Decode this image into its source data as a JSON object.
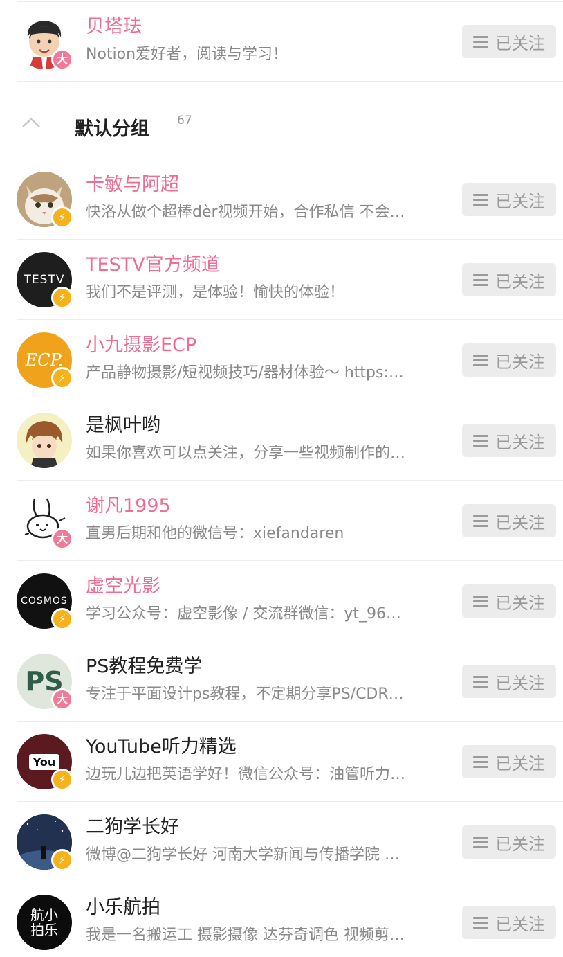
{
  "top_row": {
    "name": "贝塔珐",
    "desc": "Notion爱好者，阅读与学习！",
    "badge": "大",
    "button": "已关注"
  },
  "group": {
    "title": "默认分组",
    "count": "67"
  },
  "colors": {
    "pink_name": "#ef6d90",
    "vip_badge": "#f07a98",
    "bolt_badge": "#f5b21b",
    "button_bg": "#ececec",
    "button_text": "#9a9a9a"
  },
  "list": [
    {
      "name": "卡敏与阿超",
      "desc": "快洛从做个超棒dèr视频开始，合作私信 不会…",
      "badge": "⚡",
      "button": "已关注"
    },
    {
      "name": "TESTV官方频道",
      "desc": "我们不是评测，是体验！愉快的体验！",
      "badge": "⚡",
      "button": "已关注",
      "avatar_text": "TESTV"
    },
    {
      "name": "小九摄影ECP",
      "desc": "产品静物摄影/短视频技巧/器材体验～ https:…",
      "badge": "⚡",
      "button": "已关注",
      "avatar_text": "ECP."
    },
    {
      "name": "是枫叶哟",
      "desc": "如果你喜欢可以点关注，分享一些视频制作的…",
      "badge": "",
      "button": "已关注"
    },
    {
      "name": "谢凡1995",
      "desc": "直男后期和他的微信号：xiefandaren",
      "badge": "大",
      "button": "已关注"
    },
    {
      "name": "虚空光影",
      "desc": "学习公众号：虚空影像 / 交流群微信：yt_96…",
      "badge": "⚡",
      "button": "已关注",
      "avatar_text": "COSMOS"
    },
    {
      "name": "PS教程免费学",
      "desc": "专注于平面设计ps教程，不定期分享PS/CDR…",
      "badge": "大",
      "button": "已关注",
      "avatar_text": "PS"
    },
    {
      "name": "YouTube听力精选",
      "desc": "边玩儿边把英语学好！微信公众号：油管听力…",
      "badge": "⚡",
      "button": "已关注",
      "avatar_text": "You"
    },
    {
      "name": "二狗学长好",
      "desc": "微博@二狗学长好 河南大学新闻与传播学院 …",
      "badge": "⚡",
      "button": "已关注"
    },
    {
      "name": "小乐航拍",
      "desc": "我是一名搬运工 摄影摄像 达芬奇调色 视频剪…",
      "badge": "",
      "button": "已关注",
      "avatar_text": "航小拍乐"
    }
  ]
}
